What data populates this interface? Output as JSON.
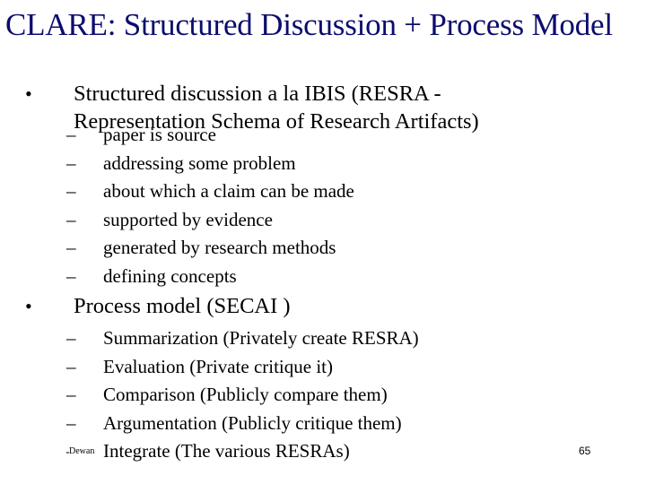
{
  "slide": {
    "title": "CLARE: Structured Discussion + Process Model",
    "title_color": "#0c0c6e",
    "bullets": [
      {
        "bullet_glyph": "•",
        "lines": [
          "Structured discussion a la IBIS (RESRA -",
          "Representation Schema of Research Artifacts)"
        ],
        "subitems": [
          "paper is source",
          "addressing some problem",
          "about which a claim can be made",
          "supported by evidence",
          "generated by research methods",
          "defining concepts"
        ]
      },
      {
        "bullet_glyph": "•",
        "lines": [
          "Process model (SECAI )"
        ],
        "subitems": [
          "Summarization (Privately create RESRA)",
          "Evaluation (Private critique it)",
          "Comparison (Publicly compare them)",
          "Argumentation (Publicly critique them)",
          "Integrate (The various RESRAs)"
        ]
      }
    ],
    "dash_glyph": "–",
    "footer": {
      "author": "Dewan",
      "page_number": "65"
    }
  }
}
